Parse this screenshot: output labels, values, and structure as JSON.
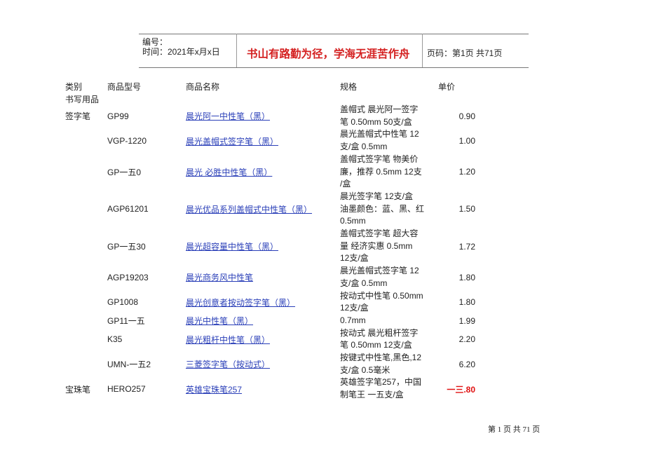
{
  "header": {
    "number_label": "编号：",
    "date_label": "时间：2021年x月x日",
    "motto": "书山有路勤为径，学海无涯苦作舟",
    "page_info": "页码：第1页  共71页"
  },
  "columns": {
    "category": "类别",
    "code": "商品型号",
    "name": "商品名称",
    "spec": "规格",
    "price": "单价"
  },
  "section": "书写用品",
  "rows": [
    {
      "category": "签字笔",
      "code": "GP99",
      "name": "晨光阿一中性笔（黑）",
      "spec": [
        "盖帽式  晨光阿一签字",
        "笔  0.50mm 50支/盒"
      ],
      "price": "0.90"
    },
    {
      "category": "",
      "code": "VGP-1220",
      "name": "晨光盖帽式签字笔（黑）",
      "spec": [
        "晨光盖帽式中性笔  12",
        "支/盒  0.5mm"
      ],
      "price": "1.00"
    },
    {
      "category": "",
      "code": "GP一五0",
      "name": "晨光  必胜中性笔（黑）",
      "spec": [
        "盖帽式签字笔  物美价",
        "廉，推荐  0.5mm 12支",
        "/盒"
      ],
      "price": "1.20"
    },
    {
      "category": "",
      "code": "AGP61201",
      "name": "晨光优品系列盖帽式中性笔（黑）",
      "spec": [
        "晨光签字笔  12支/盒",
        "油墨颜色：蓝、黑、红",
        "0.5mm"
      ],
      "price": "1.50"
    },
    {
      "category": "",
      "code": "GP一五30",
      "name": "晨光超容量中性笔（黑）",
      "spec": [
        "盖帽式签字笔  超大容",
        "量  经济实惠  0.5mm",
        "12支/盒"
      ],
      "price": "1.72"
    },
    {
      "category": "",
      "code": "AGP19203",
      "name": "晨光商务风中性笔",
      "spec": [
        "晨光盖帽式签字笔  12",
        "支/盒  0.5mm"
      ],
      "price": "1.80"
    },
    {
      "category": "",
      "code": "GP1008",
      "name": "晨光创意者按动签字笔（黑）",
      "spec": [
        "按动式中性笔  0.50mm",
        "12支/盒"
      ],
      "price": "1.80"
    },
    {
      "category": "",
      "code": "GP11一五",
      "name": "晨光中性笔（黑）",
      "spec": [
        "0.7mm"
      ],
      "price": "1.99"
    },
    {
      "category": "",
      "code": "K35",
      "name": "晨光粗杆中性笔（黑）",
      "spec": [
        "按动式  晨光粗杆签字",
        "笔  0.50mm 12支/盒"
      ],
      "price": "2.20"
    },
    {
      "category": "",
      "code": "UMN-一五2",
      "name": "三菱签字笔（按动式）",
      "spec": [
        "按键式中性笔,黑色,12",
        "支/盒  0.5毫米"
      ],
      "price": "6.20"
    },
    {
      "category": "宝珠笔",
      "code": "HERO257",
      "name": "英雄宝珠笔257",
      "spec": [
        "英雄签字笔257，中国",
        "制笔王  一五支/盒"
      ],
      "price": "一三.80",
      "highlight": true
    }
  ],
  "footer": "第 1 页 共 71 页",
  "colors": {
    "motto": "#d42020",
    "link": "#2a3fb8",
    "highlight_price": "#e01010"
  }
}
